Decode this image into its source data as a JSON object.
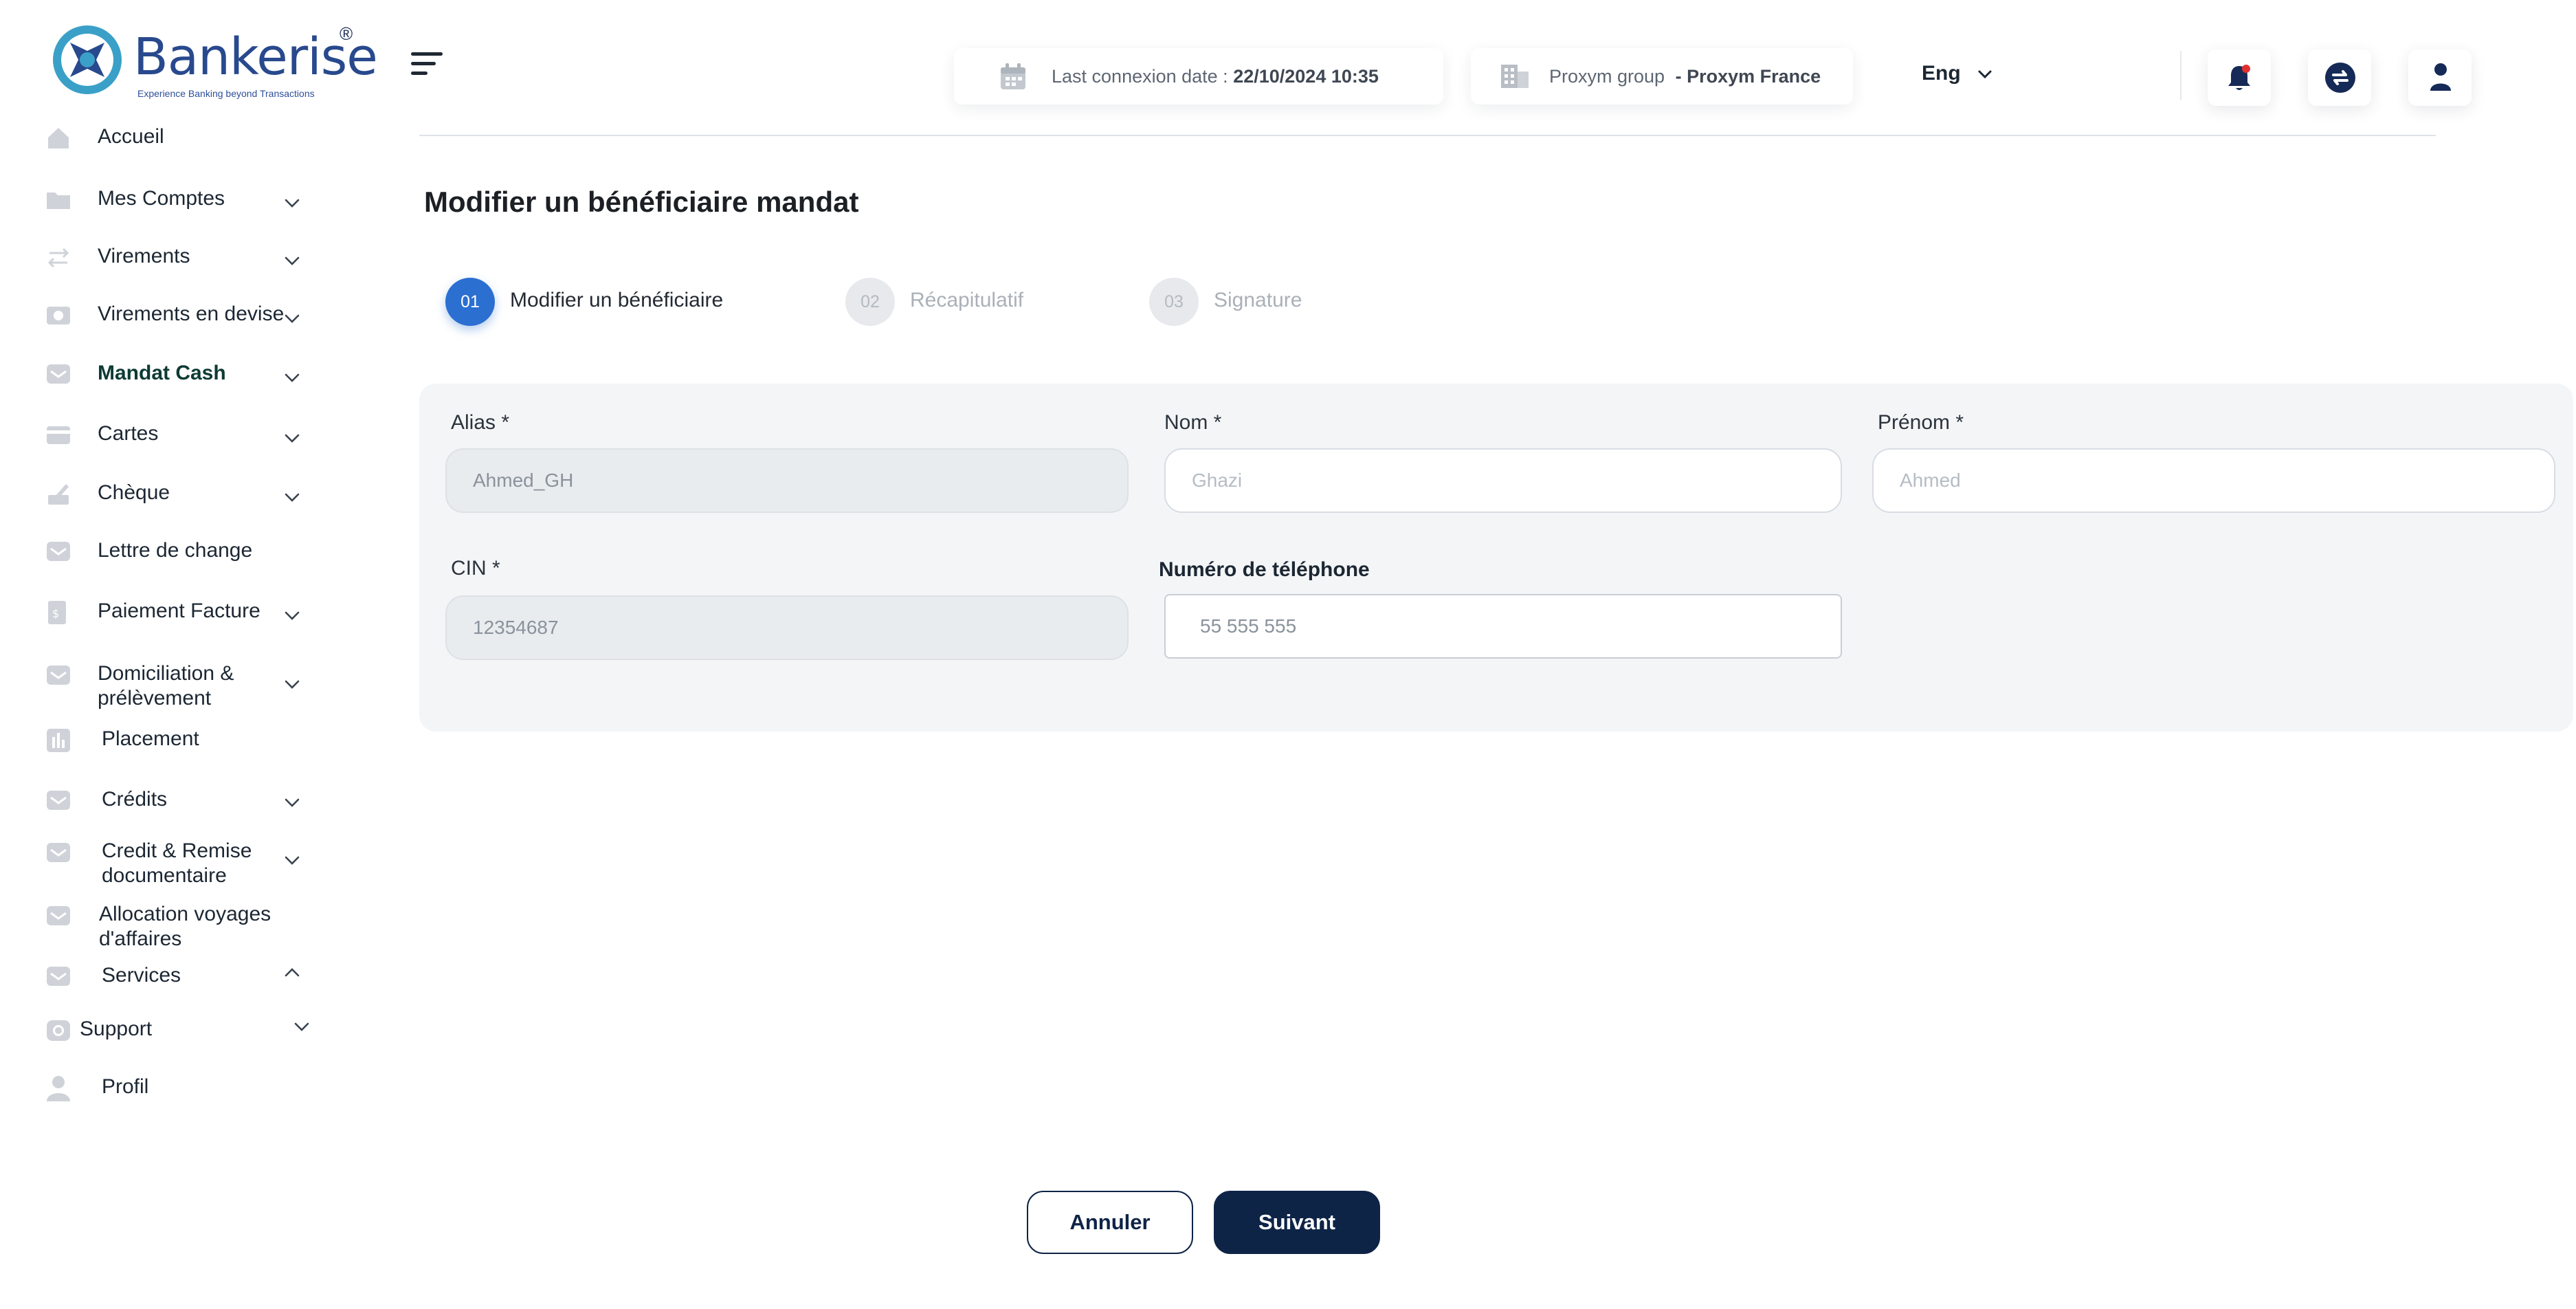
{
  "brand": {
    "name": "Bankerise",
    "registered_mark": "®",
    "tagline": "Experience Banking beyond Transactions",
    "primary_color": "#28498d",
    "accent_color": "#3aa0c8"
  },
  "sidebar": {
    "items": [
      {
        "label": "Accueil",
        "icon": "home-icon",
        "has_chevron": false
      },
      {
        "label": "Mes Comptes",
        "icon": "folder-icon",
        "has_chevron": true
      },
      {
        "label": "Virements",
        "icon": "transfer-arrows-icon",
        "has_chevron": true
      },
      {
        "label": "Virements en devise",
        "icon": "currency-icon",
        "has_chevron": true
      },
      {
        "label": "Mandat Cash",
        "icon": "envelope-icon",
        "has_chevron": true,
        "active": true
      },
      {
        "label": "Cartes",
        "icon": "card-icon",
        "has_chevron": true
      },
      {
        "label": "Chèque",
        "icon": "cheque-icon",
        "has_chevron": true
      },
      {
        "label": "Lettre de change",
        "icon": "envelope-icon",
        "has_chevron": false
      },
      {
        "label": "Paiement Facture",
        "icon": "invoice-icon",
        "has_chevron": true
      },
      {
        "label": "Domiciliation & prélèvement",
        "icon": "envelope-icon",
        "has_chevron": true
      },
      {
        "label": "Placement",
        "icon": "bar-chart-icon",
        "has_chevron": false
      },
      {
        "label": "Crédits",
        "icon": "envelope-icon",
        "has_chevron": true
      },
      {
        "label": "Credit & Remise documentaire",
        "icon": "envelope-icon",
        "has_chevron": true
      },
      {
        "label": "Allocation  voyages d'affaires",
        "icon": "envelope-icon",
        "has_chevron": false
      },
      {
        "label": "Services",
        "icon": "envelope-icon",
        "has_chevron": true,
        "expanded": true
      },
      {
        "label": "Support",
        "icon": "support-icon",
        "has_chevron": true
      },
      {
        "label": "Profil",
        "icon": "user-icon",
        "has_chevron": false
      }
    ]
  },
  "header": {
    "last_connexion_label": "Last connexion date :",
    "last_connexion_value": "22/10/2024 10:35",
    "group_label": "Proxym group",
    "group_value": "- Proxym France",
    "language": "Eng"
  },
  "page": {
    "title": "Modifier  un bénéficiaire mandat"
  },
  "stepper": {
    "steps": [
      {
        "number": "01",
        "label": "Modifier un bénéficiaire",
        "active": true
      },
      {
        "number": "02",
        "label": "Récapitulatif",
        "active": false
      },
      {
        "number": "03",
        "label": "Signature",
        "active": false
      }
    ]
  },
  "form": {
    "alias": {
      "label": "Alias *",
      "value": "Ahmed_GH"
    },
    "nom": {
      "label": "Nom *",
      "placeholder": "Ghazi"
    },
    "prenom": {
      "label": "Prénom *",
      "placeholder": "Ahmed"
    },
    "cin": {
      "label": "CIN *",
      "value": "12354687"
    },
    "telephone": {
      "label": "Numéro de téléphone",
      "value": "55 555 555"
    }
  },
  "actions": {
    "cancel_label": "Annuler",
    "next_label": "Suivant"
  }
}
